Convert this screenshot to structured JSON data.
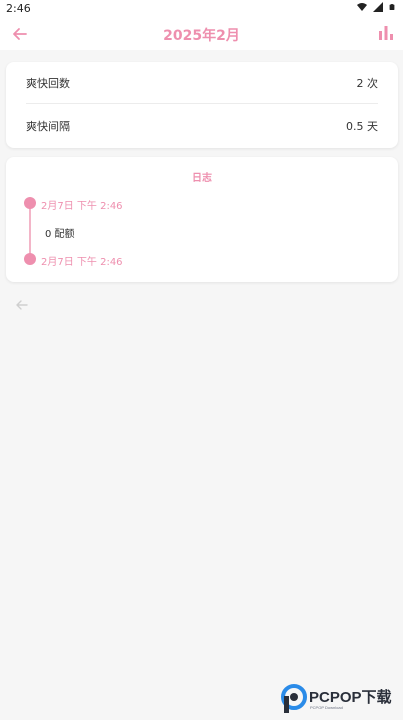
{
  "status_bar": {
    "time": "2:46",
    "icons": [
      "wifi-icon",
      "signal-icon",
      "battery-icon"
    ]
  },
  "app_bar": {
    "title": "2025年2月",
    "back_icon": "arrow-left-icon",
    "chart_icon": "bar-chart-icon"
  },
  "stats": {
    "count_label": "爽快回数",
    "count_value": "2 次",
    "interval_label": "爽快间隔",
    "interval_value": "0.5 天"
  },
  "log": {
    "title": "日志",
    "entries": [
      {
        "time": "2月7日  下午 2:46"
      },
      {
        "time": "2月7日  下午 2:46"
      }
    ],
    "note": "0 配额"
  },
  "watermark": {
    "brand": "PCPOP下载",
    "sub": "PCPOP Download"
  },
  "colors": {
    "accent": "#ee8fae",
    "accent_light": "#f3b5c8",
    "background": "#f6f6f6",
    "card": "#ffffff"
  }
}
